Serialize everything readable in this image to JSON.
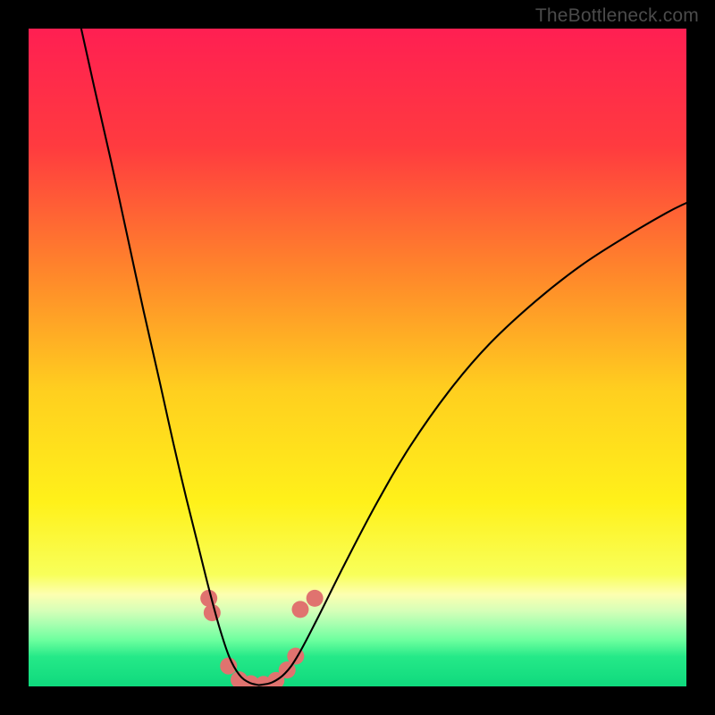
{
  "watermark": "TheBottleneck.com",
  "chart_data": {
    "type": "line",
    "title": "",
    "xlabel": "",
    "ylabel": "",
    "xlim": [
      0,
      100
    ],
    "ylim": [
      0,
      100
    ],
    "grid": false,
    "background_gradient": {
      "stops": [
        {
          "offset": 0.0,
          "color": "#ff1f52"
        },
        {
          "offset": 0.18,
          "color": "#ff3b3f"
        },
        {
          "offset": 0.38,
          "color": "#ff8a2a"
        },
        {
          "offset": 0.55,
          "color": "#ffcf1f"
        },
        {
          "offset": 0.72,
          "color": "#fff11a"
        },
        {
          "offset": 0.83,
          "color": "#f8ff5a"
        },
        {
          "offset": 0.86,
          "color": "#fdffb0"
        },
        {
          "offset": 0.885,
          "color": "#d6ffb8"
        },
        {
          "offset": 0.905,
          "color": "#a8ffb0"
        },
        {
          "offset": 0.93,
          "color": "#6cff9e"
        },
        {
          "offset": 0.955,
          "color": "#25e988"
        },
        {
          "offset": 1.0,
          "color": "#0fd97d"
        }
      ]
    },
    "series": [
      {
        "name": "left-arm",
        "stroke": "#000000",
        "stroke_width": 2.1,
        "points": [
          {
            "x": 8.0,
            "y": 100.0
          },
          {
            "x": 10.0,
            "y": 91.0
          },
          {
            "x": 12.5,
            "y": 80.0
          },
          {
            "x": 15.0,
            "y": 68.5
          },
          {
            "x": 17.5,
            "y": 57.0
          },
          {
            "x": 20.0,
            "y": 46.0
          },
          {
            "x": 22.0,
            "y": 37.0
          },
          {
            "x": 24.0,
            "y": 28.5
          },
          {
            "x": 26.0,
            "y": 20.5
          },
          {
            "x": 27.5,
            "y": 14.5
          },
          {
            "x": 29.0,
            "y": 9.0
          },
          {
            "x": 30.5,
            "y": 4.5
          },
          {
            "x": 32.0,
            "y": 1.8
          },
          {
            "x": 33.5,
            "y": 0.6
          },
          {
            "x": 35.0,
            "y": 0.2
          }
        ]
      },
      {
        "name": "right-arm",
        "stroke": "#000000",
        "stroke_width": 2.1,
        "points": [
          {
            "x": 35.0,
            "y": 0.2
          },
          {
            "x": 37.0,
            "y": 0.6
          },
          {
            "x": 39.0,
            "y": 2.0
          },
          {
            "x": 41.0,
            "y": 4.8
          },
          {
            "x": 44.0,
            "y": 10.5
          },
          {
            "x": 48.0,
            "y": 18.5
          },
          {
            "x": 53.0,
            "y": 28.0
          },
          {
            "x": 58.0,
            "y": 36.5
          },
          {
            "x": 64.0,
            "y": 45.0
          },
          {
            "x": 70.0,
            "y": 52.0
          },
          {
            "x": 77.0,
            "y": 58.5
          },
          {
            "x": 84.0,
            "y": 64.0
          },
          {
            "x": 91.0,
            "y": 68.5
          },
          {
            "x": 97.0,
            "y": 72.0
          },
          {
            "x": 100.0,
            "y": 73.5
          }
        ]
      }
    ],
    "markers": {
      "name": "highlight-dots",
      "fill": "#e0736f",
      "radius": 9.5,
      "points": [
        {
          "x": 27.4,
          "y": 13.4
        },
        {
          "x": 27.9,
          "y": 11.2
        },
        {
          "x": 30.4,
          "y": 3.1
        },
        {
          "x": 32.0,
          "y": 1.0
        },
        {
          "x": 33.8,
          "y": 0.4
        },
        {
          "x": 35.7,
          "y": 0.3
        },
        {
          "x": 37.6,
          "y": 0.9
        },
        {
          "x": 39.3,
          "y": 2.5
        },
        {
          "x": 40.6,
          "y": 4.6
        },
        {
          "x": 41.3,
          "y": 11.7
        },
        {
          "x": 43.5,
          "y": 13.4
        }
      ]
    }
  }
}
